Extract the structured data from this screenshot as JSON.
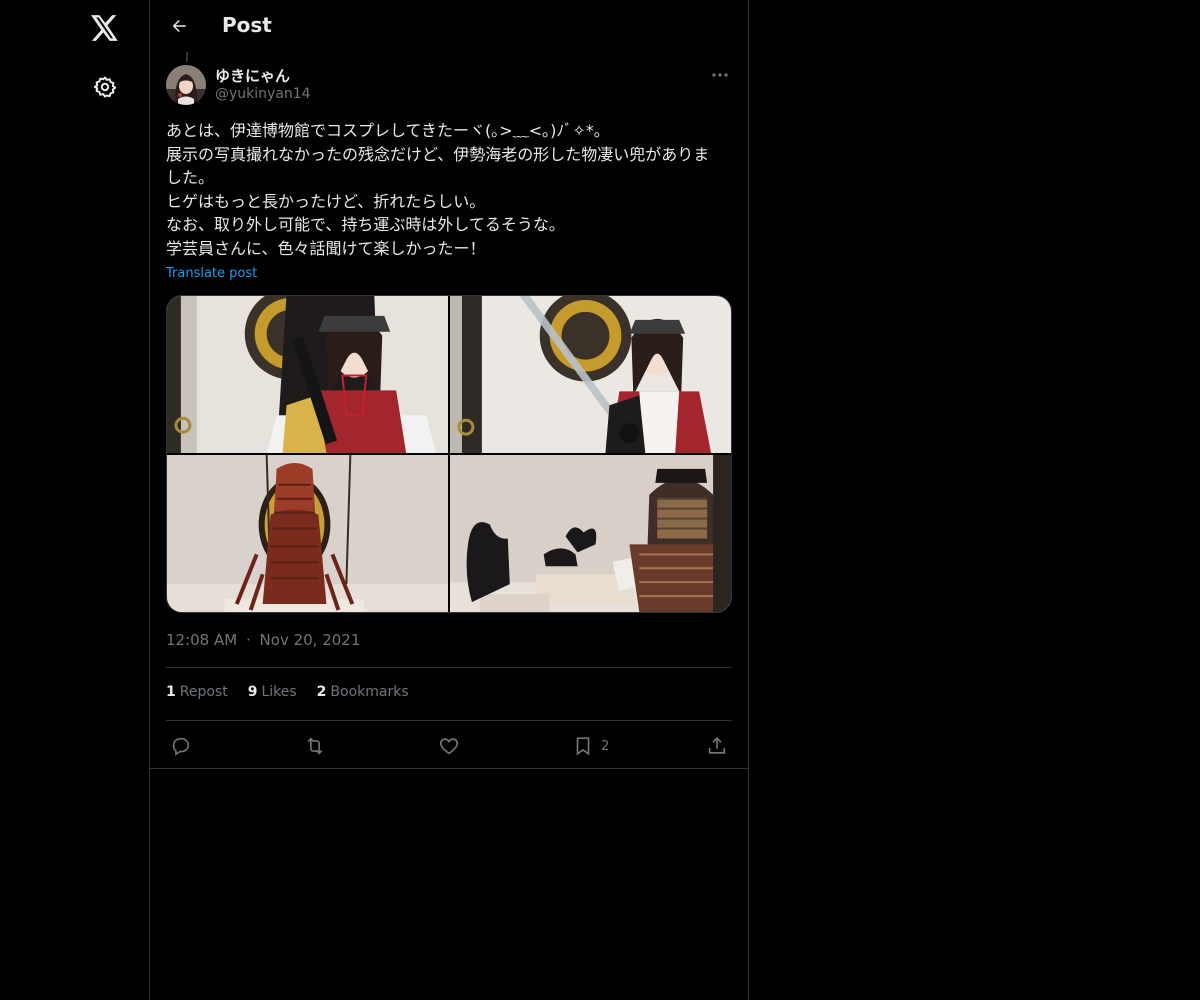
{
  "topbar": {
    "title": "Post"
  },
  "author": {
    "display_name": "ゆきにゃん",
    "handle": "@yukinyan14"
  },
  "post": {
    "lines": [
      "あとは、伊達博物館でコスプレしてきたーヾ(｡>﹏<｡)ﾉﾞ✧*。",
      "展示の写真撮れなかったの残念だけど、伊勢海老の形した物凄い兜がありま",
      "した。",
      "ヒゲはもっと長かったけど、折れたらしい。",
      "なお、取り外し可能で、持ち運ぶ時は外してるそうな。",
      "学芸員さんに、色々話聞けて楽しかったー！"
    ],
    "translate_label": "Translate post",
    "time": "12:08 AM",
    "separator": "·",
    "date": "Nov 20, 2021"
  },
  "stats": {
    "reposts_count": "1",
    "reposts_label": "Repost",
    "likes_count": "9",
    "likes_label": "Likes",
    "bookmarks_count": "2",
    "bookmarks_label": "Bookmarks"
  },
  "actions": {
    "bookmark_count": "2"
  },
  "colors": {
    "accent": "#1d9bf0",
    "text": "#e7e9ea",
    "muted": "#71767b",
    "border": "#2f3336",
    "background": "#000000"
  },
  "icons": {
    "logo": "x-logo-icon",
    "settings": "gear-icon",
    "back": "arrow-left-icon",
    "more": "more-horizontal-icon",
    "reply": "reply-icon",
    "repost": "repost-icon",
    "like": "heart-icon",
    "bookmark": "bookmark-icon",
    "share": "share-icon"
  }
}
